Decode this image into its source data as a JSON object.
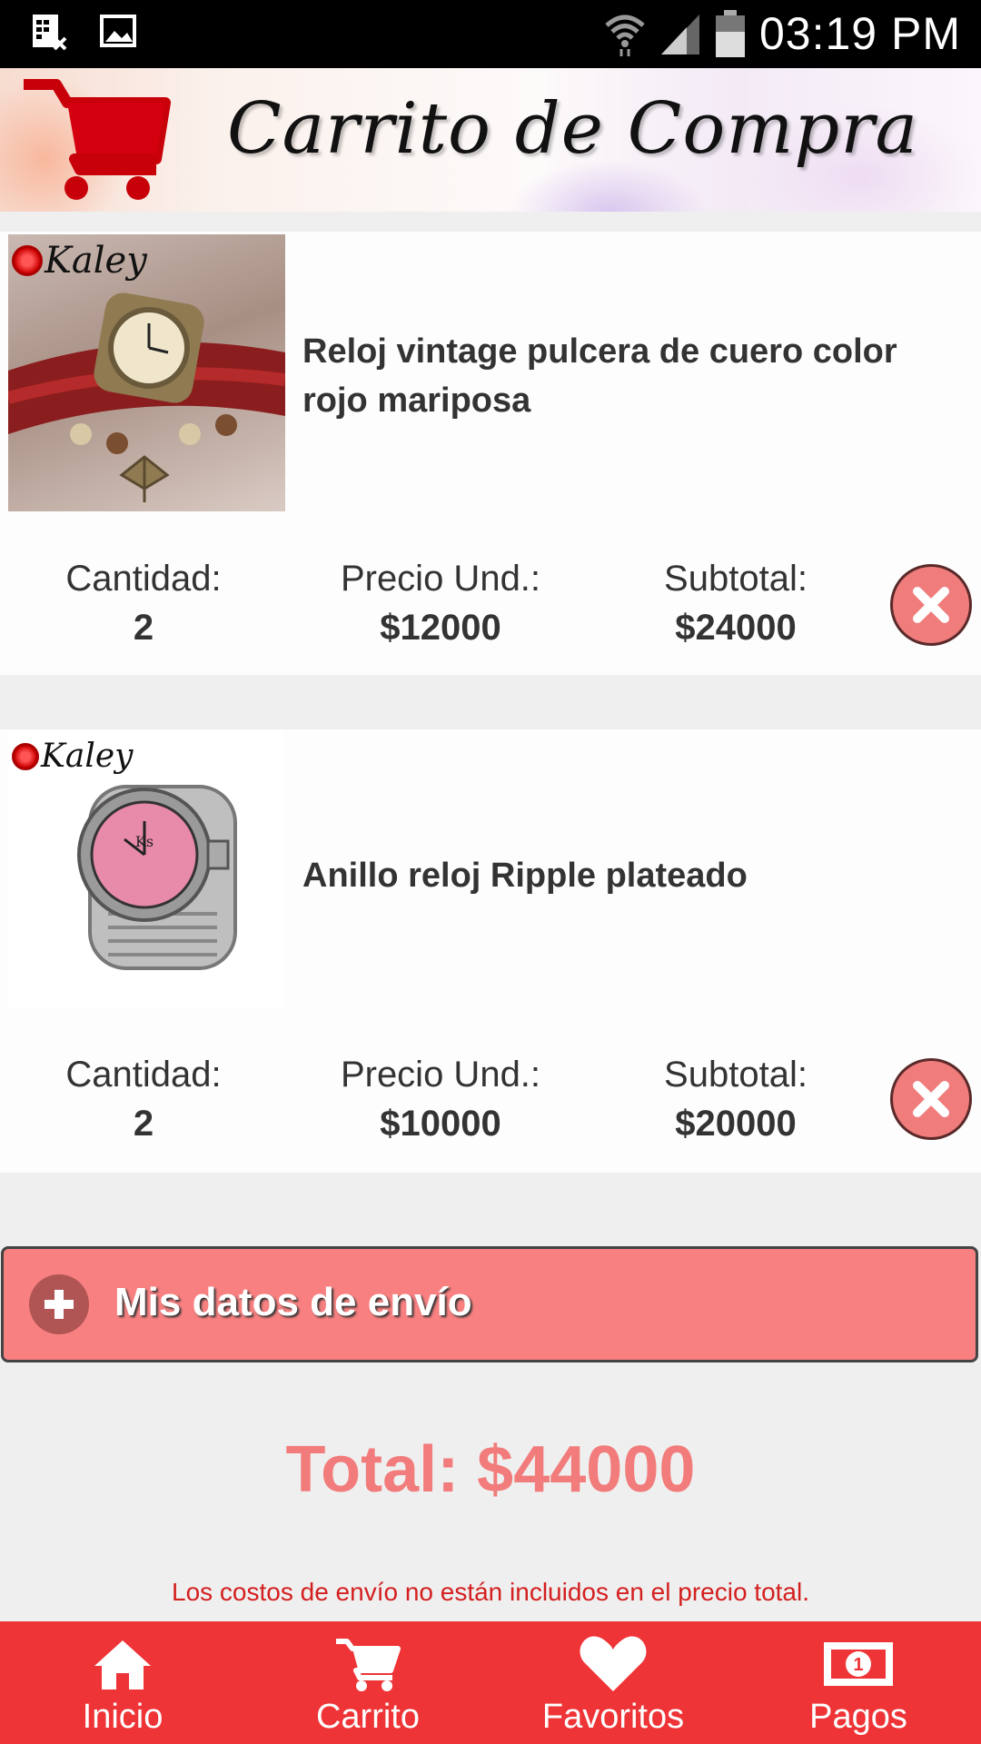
{
  "status_bar": {
    "time": "03:19 PM",
    "icons": [
      "calculator-icon",
      "image-icon",
      "wifi-icon",
      "signal-icon",
      "battery-icon"
    ]
  },
  "header": {
    "title": "Carrito de Compra",
    "logo_icon": "shopping-cart-icon"
  },
  "cart": {
    "labels": {
      "quantity": "Cantidad:",
      "unit_price": "Precio Und.:",
      "subtotal": "Subtotal:"
    },
    "items": [
      {
        "brand": "Kaley",
        "name": "Reloj vintage pulcera de cuero color rojo mariposa",
        "quantity": "2",
        "unit_price": "$12000",
        "subtotal": "$24000"
      },
      {
        "brand": "Kaley",
        "name": "Anillo reloj Ripple plateado",
        "quantity": "2",
        "unit_price": "$10000",
        "subtotal": "$20000"
      }
    ]
  },
  "shipping_button": {
    "label": "Mis datos de envío"
  },
  "total": {
    "text": "Total: $44000"
  },
  "shipping_note": "Los costos de envío no están incluidos en el precio total.",
  "bottom_nav": {
    "items": [
      {
        "label": "Inicio",
        "icon": "home-icon"
      },
      {
        "label": "Carrito",
        "icon": "cart-icon"
      },
      {
        "label": "Favoritos",
        "icon": "heart-icon"
      },
      {
        "label": "Pagos",
        "icon": "money-icon"
      }
    ]
  },
  "colors": {
    "accent": "#ee3437",
    "shipping_button": "#f88080",
    "total": "#f27b7b",
    "note": "#d41f1f"
  }
}
